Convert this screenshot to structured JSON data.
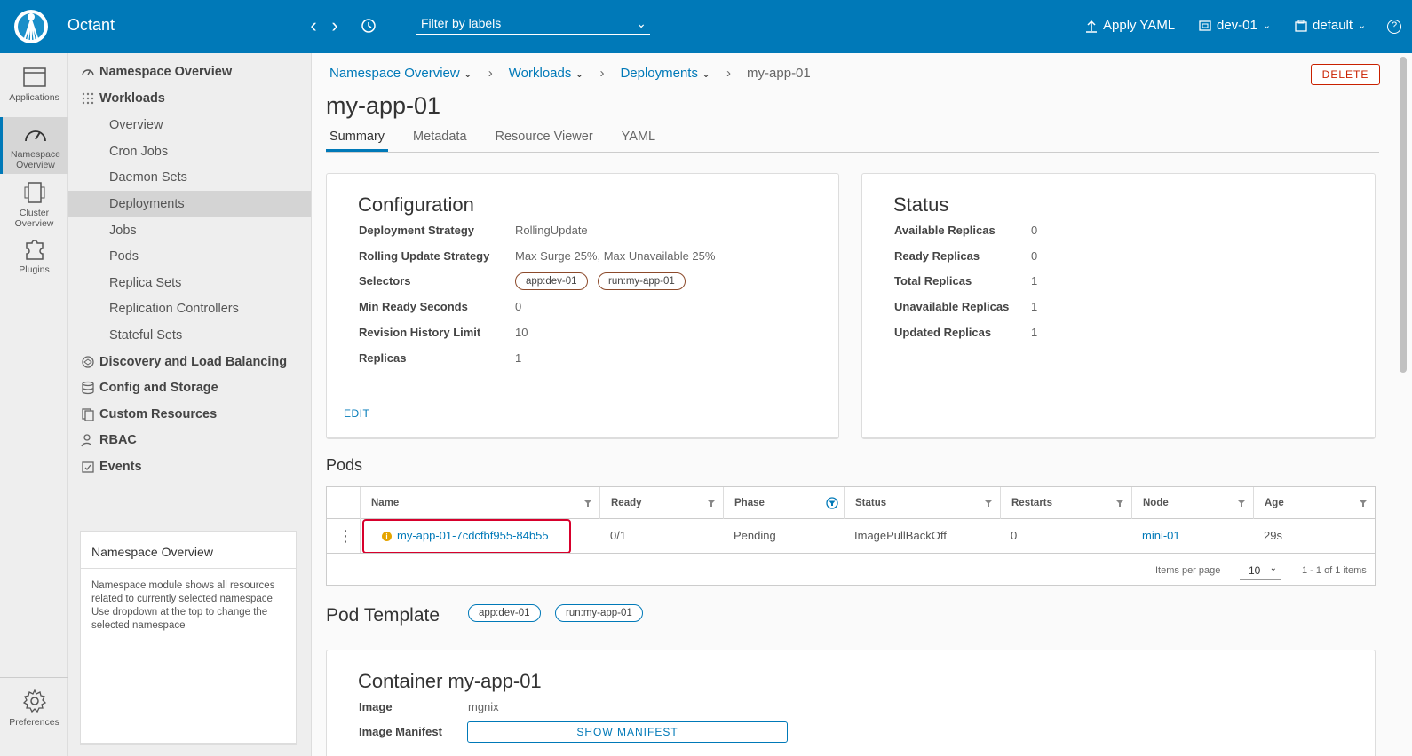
{
  "header": {
    "brand": "Octant",
    "filter_placeholder": "Filter by labels",
    "apply_label": "Apply YAML",
    "context": "dev-01",
    "namespace": "default",
    "help": "?"
  },
  "rail": [
    {
      "label": "Applications",
      "icon": "browser-icon"
    },
    {
      "label": "Namespace Overview",
      "icon": "dashboard-icon"
    },
    {
      "label": "Cluster Overview",
      "icon": "cluster-icon"
    },
    {
      "label": "Plugins",
      "icon": "puzzle-icon"
    },
    {
      "label": "Preferences",
      "icon": "gear-icon"
    }
  ],
  "sidenav": {
    "namespace_overview": "Namespace Overview",
    "workloads": "Workloads",
    "sub": [
      "Overview",
      "Cron Jobs",
      "Daemon Sets",
      "Deployments",
      "Jobs",
      "Pods",
      "Replica Sets",
      "Replication Controllers",
      "Stateful Sets"
    ],
    "discovery": "Discovery and Load Balancing",
    "config": "Config and Storage",
    "custom": "Custom Resources",
    "rbac": "RBAC",
    "events": "Events",
    "help_title": "Namespace Overview",
    "help_text": "Namespace module shows all resources related to currently selected namespace Use dropdown at the top to change the selected namespace"
  },
  "breadcrumb": {
    "items": [
      "Namespace Overview",
      "Workloads",
      "Deployments"
    ],
    "current": "my-app-01"
  },
  "delete_label": "DELETE",
  "title": "my-app-01",
  "tabs": [
    "Summary",
    "Metadata",
    "Resource Viewer",
    "YAML"
  ],
  "configuration": {
    "title": "Configuration",
    "labels": [
      "Deployment Strategy",
      "Rolling Update Strategy",
      "Selectors",
      "Min Ready Seconds",
      "Revision History Limit",
      "Replicas"
    ],
    "values": [
      "RollingUpdate",
      "Max Surge 25%, Max Unavailable 25%",
      "",
      "0",
      "10",
      "1"
    ],
    "selectors": [
      "app:dev-01",
      "run:my-app-01"
    ],
    "edit": "EDIT"
  },
  "status": {
    "title": "Status",
    "labels": [
      "Available Replicas",
      "Ready Replicas",
      "Total Replicas",
      "Unavailable Replicas",
      "Updated Replicas"
    ],
    "values": [
      "0",
      "0",
      "1",
      "1",
      "1"
    ]
  },
  "pods": {
    "title": "Pods",
    "columns": [
      "Name",
      "Ready",
      "Phase",
      "Status",
      "Restarts",
      "Node",
      "Age"
    ],
    "row": {
      "name": "my-app-01-7cdcfbf955-84b55",
      "ready": "0/1",
      "phase": "Pending",
      "status": "ImagePullBackOff",
      "restarts": "0",
      "node": "mini-01",
      "age": "29s"
    },
    "items_per_page_label": "Items per page",
    "items_per_page": "10",
    "range": "1 - 1 of 1 items"
  },
  "pod_template": {
    "title": "Pod Template",
    "labels": [
      "app:dev-01",
      "run:my-app-01"
    ],
    "container_title": "Container my-app-01",
    "image_label": "Image",
    "image_value": "mgnix",
    "manifest_label": "Image Manifest",
    "manifest_button": "SHOW MANIFEST"
  },
  "colors": {
    "brand": "#0079b8",
    "danger": "#c92100",
    "warning": "#e5a400",
    "highlight": "#d7002c"
  }
}
